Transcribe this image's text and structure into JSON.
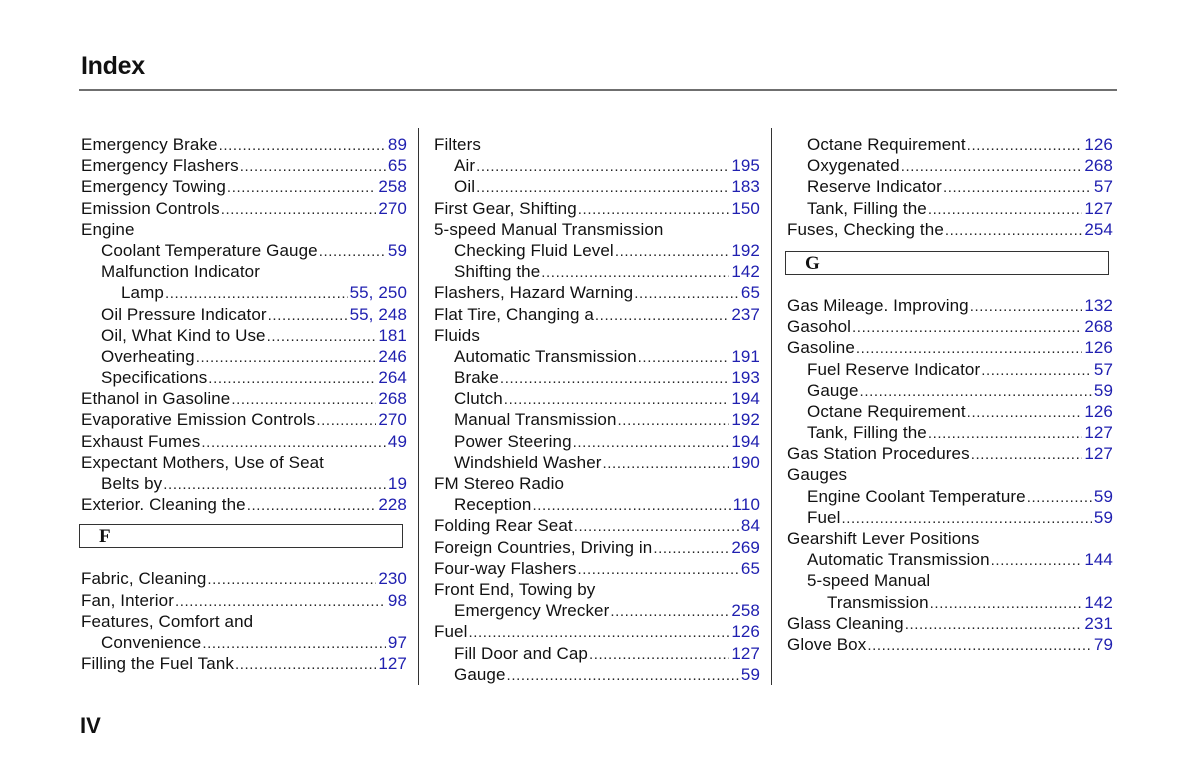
{
  "header": {
    "title": "Index"
  },
  "footer": {
    "page_number": "IV"
  },
  "colors": {
    "page_ref": "#2020b0",
    "text": "#111111",
    "rule": "#6f6f6f"
  },
  "columns": [
    {
      "blocks": [
        {
          "type": "entries",
          "entries": [
            {
              "level": 0,
              "label": "Emergency Brake",
              "page": "89"
            },
            {
              "level": 0,
              "label": "Emergency Flashers",
              "page": "65"
            },
            {
              "level": 0,
              "label": "Emergency Towing",
              "page": "258"
            },
            {
              "level": 0,
              "label": "Emission Controls",
              "page": "270"
            },
            {
              "level": 0,
              "label": "Engine",
              "page": null
            },
            {
              "level": 1,
              "label": "Coolant Temperature Gauge",
              "page": "59"
            },
            {
              "level": 1,
              "label": "Malfunction Indicator",
              "page": null
            },
            {
              "level": 2,
              "label": "Lamp",
              "page": "55, 250"
            },
            {
              "level": 1,
              "label": "Oil Pressure Indicator",
              "page": "55, 248"
            },
            {
              "level": 1,
              "label": "Oil, What Kind to Use",
              "page": "181"
            },
            {
              "level": 1,
              "label": "Overheating",
              "page": "246"
            },
            {
              "level": 1,
              "label": "Specifications",
              "page": "264"
            },
            {
              "level": 0,
              "label": "Ethanol in Gasoline",
              "page": "268"
            },
            {
              "level": 0,
              "label": "Evaporative Emission Controls",
              "page": "270"
            },
            {
              "level": 0,
              "label": "Exhaust Fumes",
              "page": "49"
            },
            {
              "level": 0,
              "label": "Expectant Mothers, Use of Seat",
              "page": null
            },
            {
              "level": 1,
              "label": "Belts by",
              "page": "19"
            },
            {
              "level": 0,
              "label": "Exterior. Cleaning the",
              "page": "228"
            }
          ]
        },
        {
          "type": "section",
          "letter": "F"
        },
        {
          "type": "entries",
          "entries": [
            {
              "level": 0,
              "label": "Fabric, Cleaning",
              "page": "230"
            },
            {
              "level": 0,
              "label": "Fan, Interior",
              "page": "98"
            },
            {
              "level": 0,
              "label": "Features, Comfort and",
              "page": null
            },
            {
              "level": 1,
              "label": "Convenience",
              "page": "97"
            },
            {
              "level": 0,
              "label": "Filling the Fuel Tank",
              "page": "127"
            }
          ]
        }
      ]
    },
    {
      "blocks": [
        {
          "type": "entries",
          "entries": [
            {
              "level": 0,
              "label": "Filters",
              "page": null
            },
            {
              "level": 1,
              "label": "Air",
              "page": "195"
            },
            {
              "level": 1,
              "label": "Oil",
              "page": "183"
            },
            {
              "level": 0,
              "label": "First Gear, Shifting",
              "page": "150"
            },
            {
              "level": 0,
              "label": "5-speed Manual Transmission",
              "page": null
            },
            {
              "level": 1,
              "label": "Checking Fluid Level",
              "page": "192"
            },
            {
              "level": 1,
              "label": "Shifting the",
              "page": "142"
            },
            {
              "level": 0,
              "label": "Flashers, Hazard Warning",
              "page": "65"
            },
            {
              "level": 0,
              "label": "Flat Tire, Changing a",
              "page": "237"
            },
            {
              "level": 0,
              "label": "Fluids",
              "page": null
            },
            {
              "level": 1,
              "label": "Automatic Transmission",
              "page": "191"
            },
            {
              "level": 1,
              "label": "Brake",
              "page": "193"
            },
            {
              "level": 1,
              "label": "Clutch",
              "page": "194"
            },
            {
              "level": 1,
              "label": "Manual Transmission",
              "page": "192"
            },
            {
              "level": 1,
              "label": "Power Steering",
              "page": "194"
            },
            {
              "level": 1,
              "label": "Windshield Washer",
              "page": "190"
            },
            {
              "level": 0,
              "label": "FM Stereo Radio",
              "page": null
            },
            {
              "level": 1,
              "label": "Reception",
              "page": "110"
            },
            {
              "level": 0,
              "label": "Folding Rear Seat",
              "page": "84"
            },
            {
              "level": 0,
              "label": "Foreign Countries, Driving in",
              "page": "269"
            },
            {
              "level": 0,
              "label": "Four-way Flashers",
              "page": "65"
            },
            {
              "level": 0,
              "label": "Front End, Towing by",
              "page": null
            },
            {
              "level": 1,
              "label": "Emergency Wrecker",
              "page": "258"
            },
            {
              "level": 0,
              "label": "Fuel",
              "page": "126"
            },
            {
              "level": 1,
              "label": "Fill Door and Cap",
              "page": "127"
            },
            {
              "level": 1,
              "label": "Gauge",
              "page": "59"
            }
          ]
        }
      ]
    },
    {
      "blocks": [
        {
          "type": "entries",
          "entries": [
            {
              "level": 1,
              "label": "Octane Requirement",
              "page": "126"
            },
            {
              "level": 1,
              "label": "Oxygenated",
              "page": "268"
            },
            {
              "level": 1,
              "label": "Reserve Indicator",
              "page": "57"
            },
            {
              "level": 1,
              "label": "Tank, Filling the",
              "page": "127"
            },
            {
              "level": 0,
              "label": "Fuses, Checking the",
              "page": "254"
            }
          ]
        },
        {
          "type": "section",
          "letter": "G"
        },
        {
          "type": "entries",
          "entries": [
            {
              "level": 0,
              "label": "Gas Mileage. Improving",
              "page": "132"
            },
            {
              "level": 0,
              "label": "Gasohol",
              "page": "268"
            },
            {
              "level": 0,
              "label": "Gasoline",
              "page": "126"
            },
            {
              "level": 1,
              "label": "Fuel Reserve Indicator",
              "page": "57"
            },
            {
              "level": 1,
              "label": "Gauge",
              "page": "59"
            },
            {
              "level": 1,
              "label": "Octane Requirement",
              "page": "126"
            },
            {
              "level": 1,
              "label": "Tank, Filling the",
              "page": "127"
            },
            {
              "level": 0,
              "label": "Gas Station Procedures",
              "page": "127"
            },
            {
              "level": 0,
              "label": "Gauges",
              "page": null
            },
            {
              "level": 1,
              "label": "Engine Coolant Temperature",
              "page": "59"
            },
            {
              "level": 1,
              "label": "Fuel",
              "page": "59"
            },
            {
              "level": 0,
              "label": "Gearshift Lever Positions",
              "page": null
            },
            {
              "level": 1,
              "label": "Automatic Transmission",
              "page": "144"
            },
            {
              "level": 1,
              "label": "5-speed Manual",
              "page": null
            },
            {
              "level": 2,
              "label": "Transmission",
              "page": "142"
            },
            {
              "level": 0,
              "label": "Glass Cleaning",
              "page": "231"
            },
            {
              "level": 0,
              "label": "Glove Box",
              "page": "79"
            }
          ]
        }
      ]
    }
  ]
}
